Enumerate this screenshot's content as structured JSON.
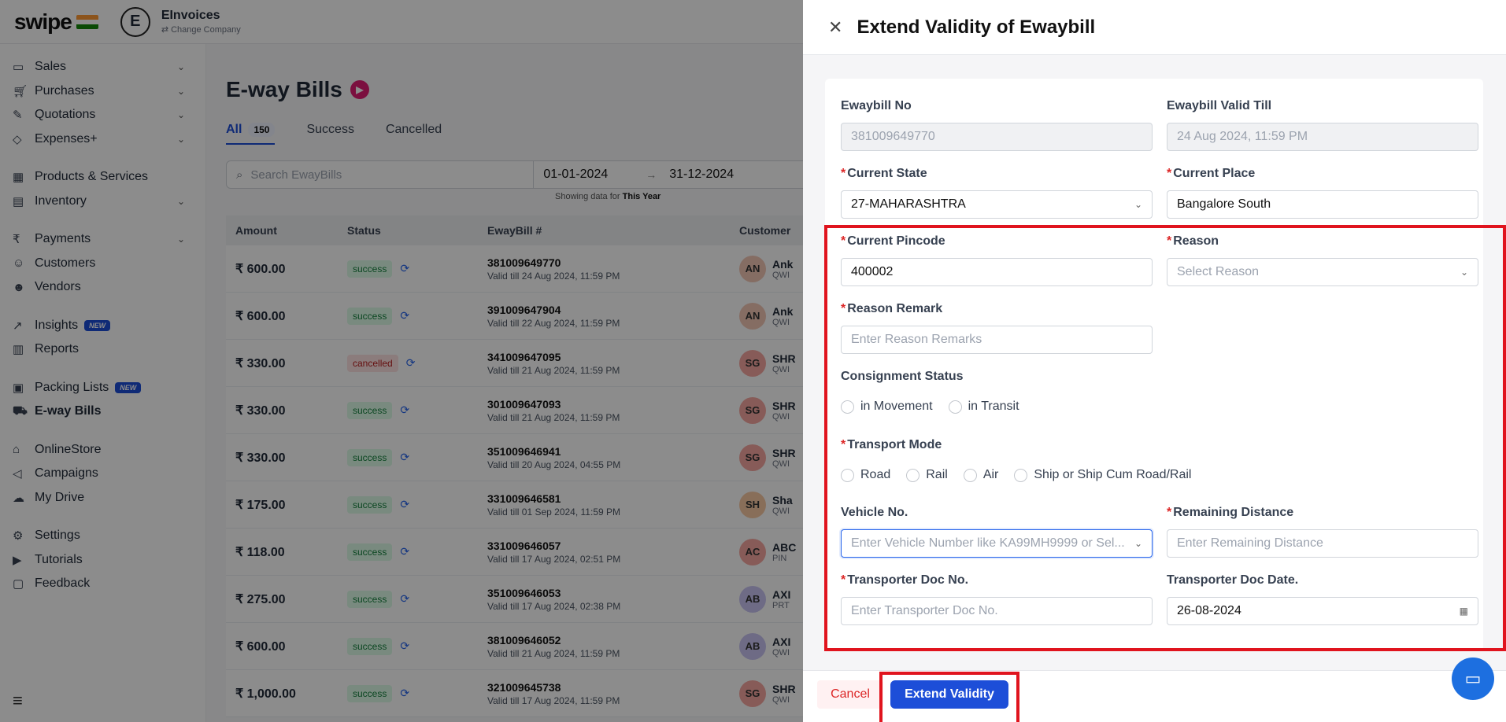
{
  "app": {
    "logo": "swipe",
    "company_initial": "E",
    "company_name": "EInvoices",
    "change_company": "Change Company"
  },
  "sidebar": {
    "items": [
      {
        "label": "Sales",
        "icon": "money-icon"
      },
      {
        "label": "Purchases",
        "icon": "cart-icon"
      },
      {
        "label": "Quotations",
        "icon": "pen-icon"
      },
      {
        "label": "Expenses+",
        "icon": "tag-icon"
      },
      {
        "label": "Products & Services",
        "icon": "box-icon"
      },
      {
        "label": "Inventory",
        "icon": "inventory-icon"
      },
      {
        "label": "Payments",
        "icon": "rupee-icon"
      },
      {
        "label": "Customers",
        "icon": "user-icon"
      },
      {
        "label": "Vendors",
        "icon": "users-icon"
      },
      {
        "label": "Insights",
        "icon": "chart-icon",
        "badge": "NEW"
      },
      {
        "label": "Reports",
        "icon": "report-icon"
      },
      {
        "label": "Packing Lists",
        "icon": "package-icon",
        "badge": "NEW"
      },
      {
        "label": "E-way Bills",
        "icon": "truck-icon"
      },
      {
        "label": "OnlineStore",
        "icon": "store-icon"
      },
      {
        "label": "Campaigns",
        "icon": "megaphone-icon"
      },
      {
        "label": "My Drive",
        "icon": "cloud-icon"
      },
      {
        "label": "Settings",
        "icon": "gear-icon"
      },
      {
        "label": "Tutorials",
        "icon": "youtube-icon"
      },
      {
        "label": "Feedback",
        "icon": "chat-icon"
      }
    ]
  },
  "main": {
    "title": "E-way Bills",
    "tabs": [
      {
        "label": "All",
        "count": "150"
      },
      {
        "label": "Success"
      },
      {
        "label": "Cancelled"
      }
    ],
    "search_placeholder": "Search EwayBills",
    "date_from": "01-01-2024",
    "date_to": "31-12-2024",
    "showing_prefix": "Showing data for",
    "showing_period": "This Year",
    "columns": [
      "Amount",
      "Status",
      "EwayBill #",
      "Customer"
    ],
    "rows": [
      {
        "amount": "₹ 600.00",
        "status": "success",
        "bill": "381009649770",
        "valid": "Valid till 24 Aug 2024, 11:59 PM",
        "initials": "AN",
        "cust": "Ank",
        "sub": "QWI",
        "color": "#f2c6b5"
      },
      {
        "amount": "₹ 600.00",
        "status": "success",
        "bill": "391009647904",
        "valid": "Valid till 22 Aug 2024, 11:59 PM",
        "initials": "AN",
        "cust": "Ank",
        "sub": "QWI",
        "color": "#f2c6b5"
      },
      {
        "amount": "₹ 330.00",
        "status": "cancelled",
        "bill": "341009647095",
        "valid": "Valid till 21 Aug 2024, 11:59 PM",
        "initials": "SG",
        "cust": "SHR",
        "sub": "QWI",
        "color": "#f6a7a0"
      },
      {
        "amount": "₹ 330.00",
        "status": "success",
        "bill": "301009647093",
        "valid": "Valid till 21 Aug 2024, 11:59 PM",
        "initials": "SG",
        "cust": "SHR",
        "sub": "QWI",
        "color": "#f6a7a0"
      },
      {
        "amount": "₹ 330.00",
        "status": "success",
        "bill": "351009646941",
        "valid": "Valid till 20 Aug 2024, 04:55 PM",
        "initials": "SG",
        "cust": "SHR",
        "sub": "QWI",
        "color": "#f6a7a0"
      },
      {
        "amount": "₹ 175.00",
        "status": "success",
        "bill": "331009646581",
        "valid": "Valid till 01 Sep 2024, 11:59 PM",
        "initials": "SH",
        "cust": "Sha",
        "sub": "QWI",
        "color": "#f8c9a3"
      },
      {
        "amount": "₹ 118.00",
        "status": "success",
        "bill": "331009646057",
        "valid": "Valid till 17 Aug 2024, 02:51 PM",
        "initials": "AC",
        "cust": "ABC",
        "sub": "PIN",
        "color": "#f6a7a0"
      },
      {
        "amount": "₹ 275.00",
        "status": "success",
        "bill": "351009646053",
        "valid": "Valid till 17 Aug 2024, 02:38 PM",
        "initials": "AB",
        "cust": "AXI",
        "sub": "PRT",
        "color": "#c8c4f2"
      },
      {
        "amount": "₹ 600.00",
        "status": "success",
        "bill": "381009646052",
        "valid": "Valid till 21 Aug 2024, 11:59 PM",
        "initials": "AB",
        "cust": "AXI",
        "sub": "QWI",
        "color": "#c8c4f2"
      },
      {
        "amount": "₹ 1,000.00",
        "status": "success",
        "bill": "321009645738",
        "valid": "Valid till 17 Aug 2024, 11:59 PM",
        "initials": "SG",
        "cust": "SHR",
        "sub": "QWI",
        "color": "#f6a7a0"
      }
    ]
  },
  "drawer": {
    "title": "Extend Validity of Ewaybill",
    "fields": {
      "ewaybill_no": {
        "label": "Ewaybill No",
        "value": "381009649770"
      },
      "valid_till": {
        "label": "Ewaybill Valid Till",
        "value": "24 Aug 2024, 11:59 PM"
      },
      "current_state": {
        "label": "Current State",
        "value": "27-MAHARASHTRA"
      },
      "current_place": {
        "label": "Current Place",
        "value": "Bangalore South"
      },
      "current_pincode": {
        "label": "Current Pincode",
        "value": "400002"
      },
      "reason": {
        "label": "Reason",
        "placeholder": "Select Reason"
      },
      "reason_remark": {
        "label": "Reason Remark",
        "placeholder": "Enter Reason Remarks"
      },
      "consignment_status": {
        "label": "Consignment Status",
        "options": [
          "in Movement",
          "in Transit"
        ]
      },
      "transport_mode": {
        "label": "Transport Mode",
        "options": [
          "Road",
          "Rail",
          "Air",
          "Ship or Ship Cum Road/Rail"
        ]
      },
      "vehicle_no": {
        "label": "Vehicle No.",
        "placeholder": "Enter Vehicle Number like KA99MH9999 or Sel..."
      },
      "remaining_distance": {
        "label": "Remaining Distance",
        "placeholder": "Enter Remaining Distance"
      },
      "transporter_doc_no": {
        "label": "Transporter Doc No.",
        "placeholder": "Enter Transporter Doc No."
      },
      "transporter_doc_date": {
        "label": "Transporter Doc Date.",
        "value": "26-08-2024"
      }
    },
    "cancel_label": "Cancel",
    "extend_label": "Extend Validity"
  },
  "colors": {
    "primary": "#1d4ed8",
    "highlight": "#e0141e",
    "danger": "#dc2626"
  }
}
